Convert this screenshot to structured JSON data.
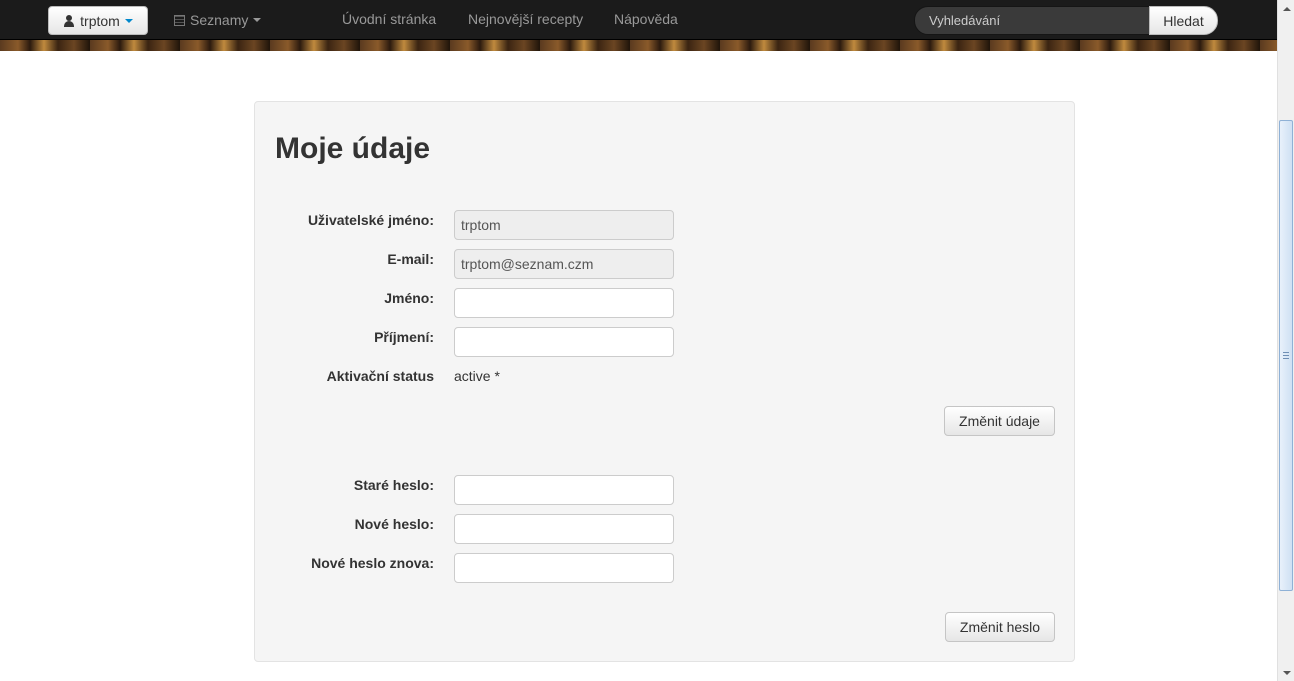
{
  "navbar": {
    "user_menu_label": "trptom",
    "lists_menu_label": "Seznamy",
    "links": [
      "Úvodní stránka",
      "Nejnovější recepty",
      "Nápověda"
    ],
    "search": {
      "placeholder": "Vyhledávání",
      "button_label": "Hledat"
    }
  },
  "profile": {
    "title": "Moje údaje",
    "fields": {
      "username": {
        "label": "Uživatelské jméno:",
        "value": "trptom"
      },
      "email": {
        "label": "E-mail:",
        "value": "trptom@seznam.czm"
      },
      "first_name": {
        "label": "Jméno:",
        "value": ""
      },
      "last_name": {
        "label": "Příjmení:",
        "value": ""
      }
    },
    "activation": {
      "label": "Aktivační status",
      "value": "active *"
    },
    "save_button_label": "Změnit údaje"
  },
  "password": {
    "old_label": "Staré heslo:",
    "new_label": "Nové heslo:",
    "confirm_label": "Nové heslo znova:",
    "button_label": "Změnit heslo"
  },
  "colors": {
    "navbar_bg": "#1b1b1b",
    "panel_bg": "#f5f5f5",
    "accent": "#0088cc"
  }
}
